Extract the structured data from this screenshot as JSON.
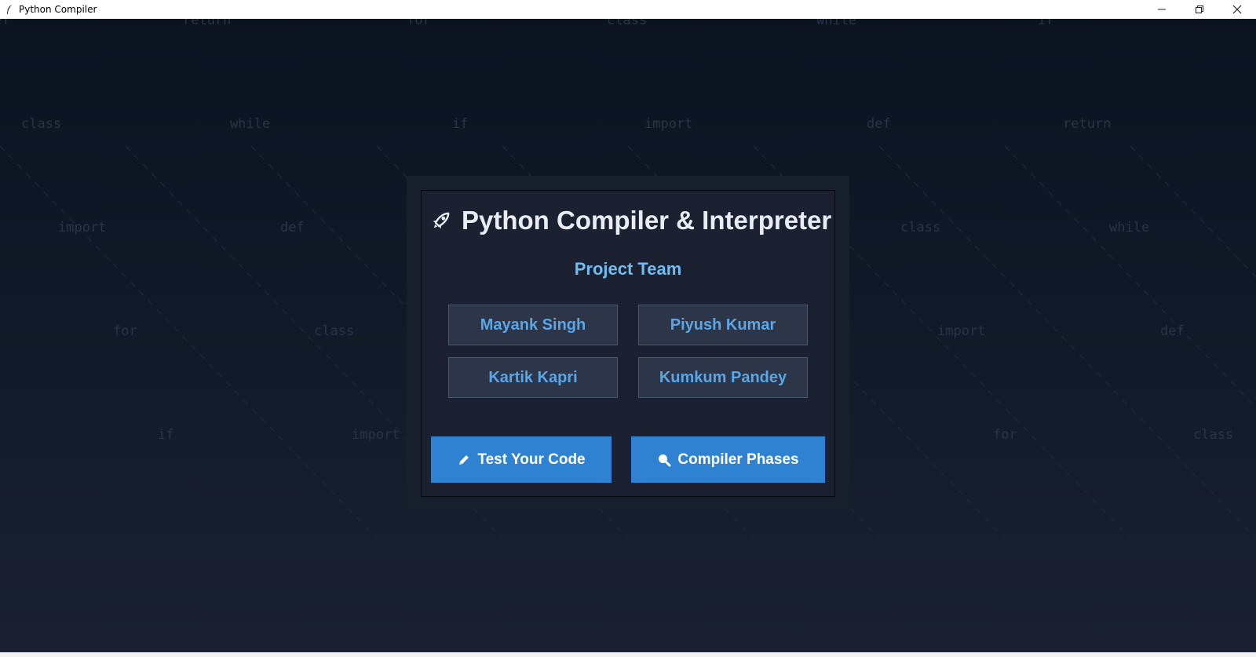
{
  "window": {
    "title": "Python Compiler",
    "controls": [
      "minimize",
      "restore",
      "close"
    ]
  },
  "background": {
    "keywords": [
      "def",
      "return",
      "for",
      "class",
      "while",
      "if",
      "class",
      "while",
      "if",
      "import",
      "def",
      "return",
      "import",
      "def",
      "for",
      "class",
      "while",
      "for",
      "class",
      "import",
      "def",
      "if",
      "import",
      "for",
      "class"
    ]
  },
  "header": {
    "title": "Python Compiler & Interpreter",
    "icon": "rocket-icon"
  },
  "team": {
    "heading": "Project Team",
    "members": [
      "Mayank Singh",
      "Piyush Kumar",
      "Kartik Kapri",
      "Kumkum Pandey"
    ]
  },
  "actions": {
    "test_code_label": "Test Your Code",
    "test_code_icon": "pencil-icon",
    "phases_label": "Compiler Phases",
    "phases_icon": "magnifier-icon"
  },
  "colors": {
    "accent": "#2f82d2",
    "member_text": "#5aa6e6",
    "heading_text": "#73bcf0"
  }
}
